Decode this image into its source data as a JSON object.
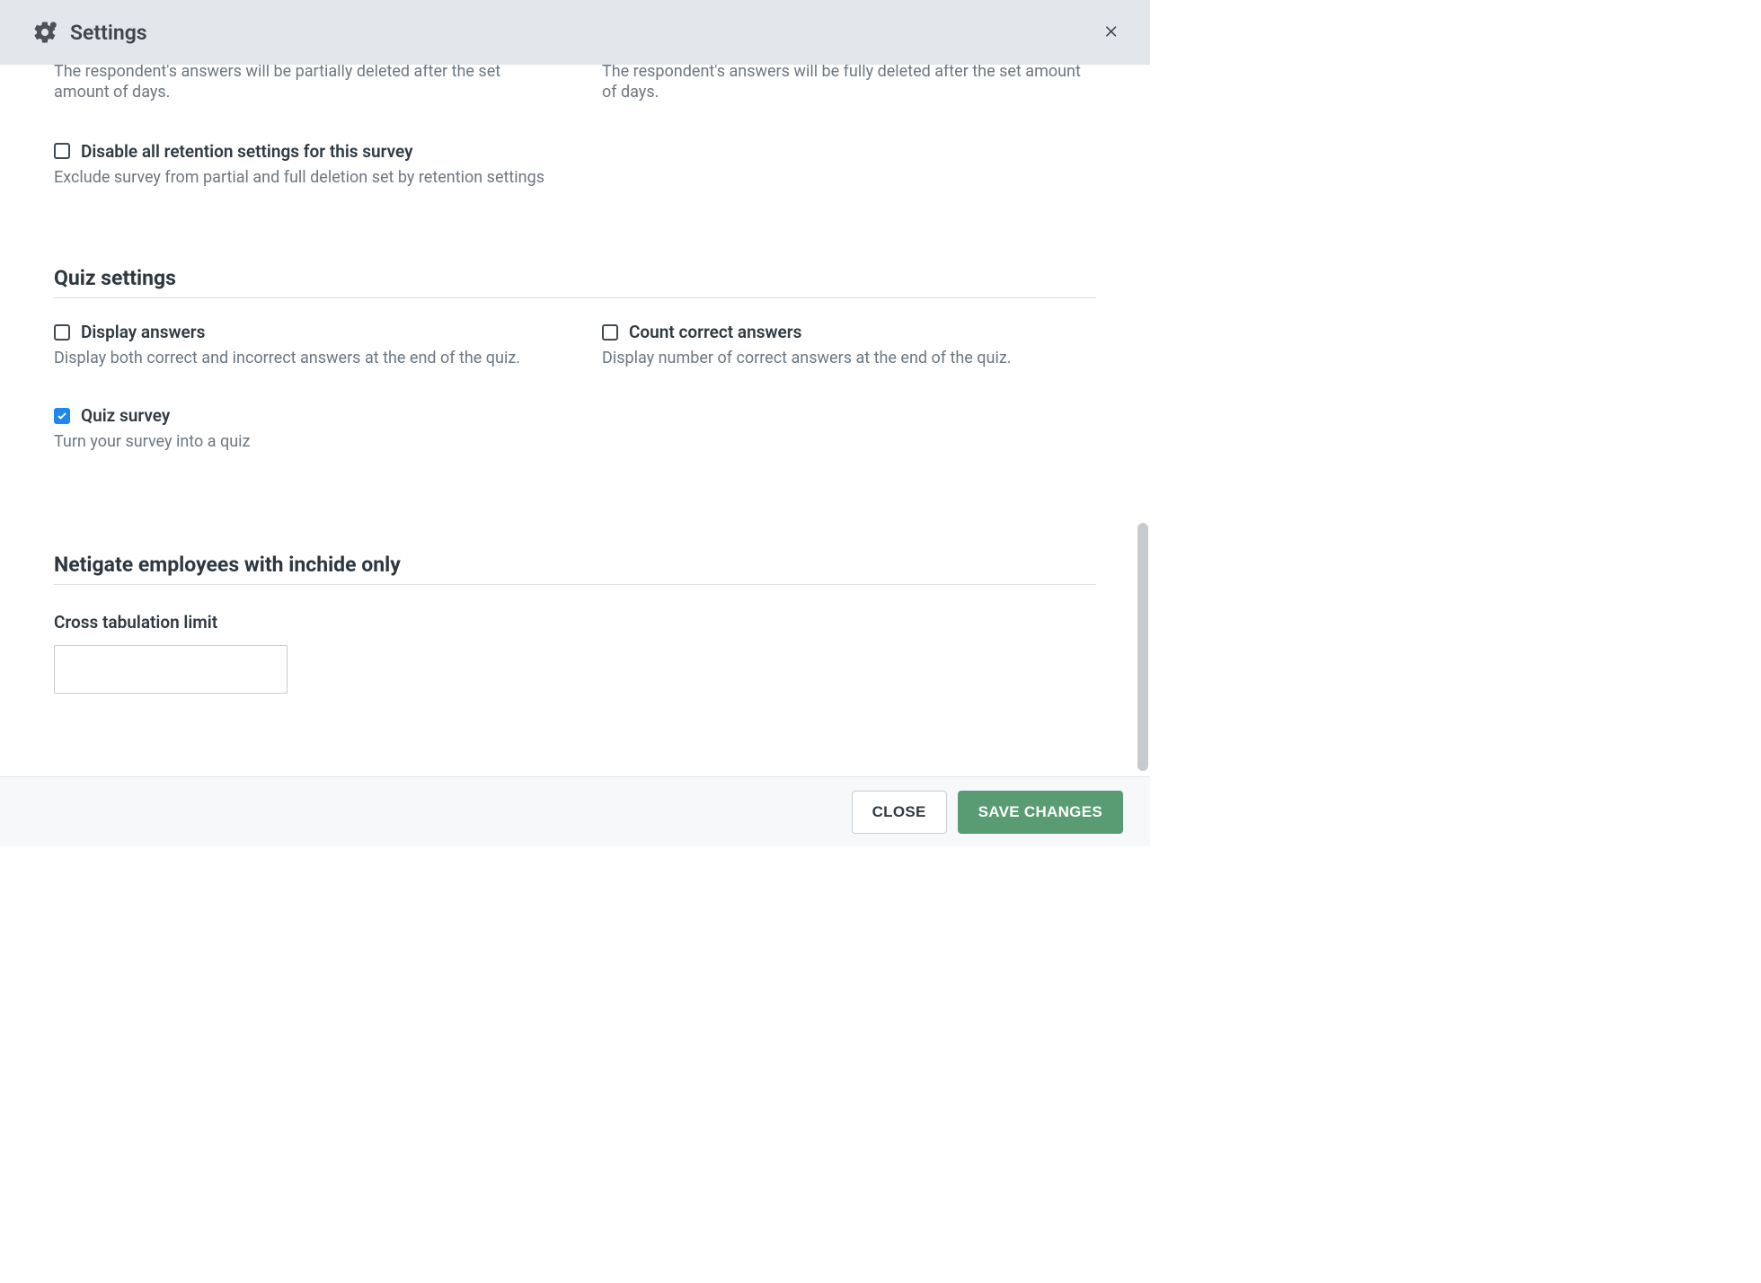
{
  "header": {
    "title": "Settings"
  },
  "retention": {
    "partial_desc": "The respondent's answers will be partially deleted after the set amount of days.",
    "full_desc": "The respondent's answers will be fully deleted after the set amount of days.",
    "disable": {
      "label": "Disable all retention settings for this survey",
      "desc": "Exclude survey from partial and full deletion set by retention settings",
      "checked": false
    }
  },
  "quiz": {
    "heading": "Quiz settings",
    "display_answers": {
      "label": "Display answers",
      "desc": "Display both correct and incorrect answers at the end of the quiz.",
      "checked": false
    },
    "count_correct": {
      "label": "Count correct answers",
      "desc": "Display number of correct answers at the end of the quiz.",
      "checked": false
    },
    "quiz_survey": {
      "label": "Quiz survey",
      "desc": "Turn your survey into a quiz",
      "checked": true
    }
  },
  "internal": {
    "heading": "Netigate employees with inchide only",
    "cross_tab_label": "Cross tabulation limit",
    "cross_tab_value": ""
  },
  "footer": {
    "close": "CLOSE",
    "save": "SAVE CHANGES"
  }
}
